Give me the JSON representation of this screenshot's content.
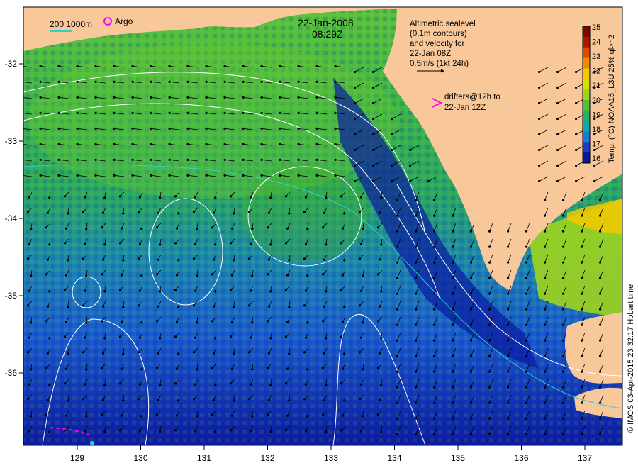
{
  "header": {
    "date": "22-Jan-2008",
    "time": "08:29Z"
  },
  "legend": {
    "depth_contours": "200  1000m",
    "argo": "Argo",
    "altimetry_lines": [
      "Altimetric sealevel",
      "(0.1m contours)",
      "and velocity for",
      "22-Jan 08Z",
      "0.5m/s (1kt 24h)"
    ],
    "drifters_lines": [
      "drifters@12h to",
      "22-Jan 12Z"
    ]
  },
  "colorbar": {
    "label": "Temp. (°C) NOAA15_L3U 25% ql>=2",
    "ticks": [
      "25",
      "24",
      "23",
      "22",
      "21",
      "20",
      "19",
      "18",
      "17",
      "16"
    ],
    "colors": [
      "#7a0a00",
      "#b01800",
      "#e04a00",
      "#f08a00",
      "#f2c800",
      "#d8e000",
      "#9ed41c",
      "#4fc23a",
      "#22b06a",
      "#10a8a8",
      "#1a7ad8",
      "#1640c8",
      "#0a1a90"
    ]
  },
  "axes": {
    "x_ticks": [
      "129",
      "130",
      "131",
      "132",
      "133",
      "134",
      "135",
      "136",
      "137"
    ],
    "y_ticks": [
      "-32",
      "-33",
      "-34",
      "-35",
      "-36"
    ]
  },
  "credit": "© IMOS 03-Apr-2015 23:32:17 Hobart time",
  "colors": {
    "land": "#f8c89a",
    "contour": "#ffffff",
    "arrow": "#000000",
    "drifter": "#ff00ff",
    "depth200": "#30d0d0"
  }
}
